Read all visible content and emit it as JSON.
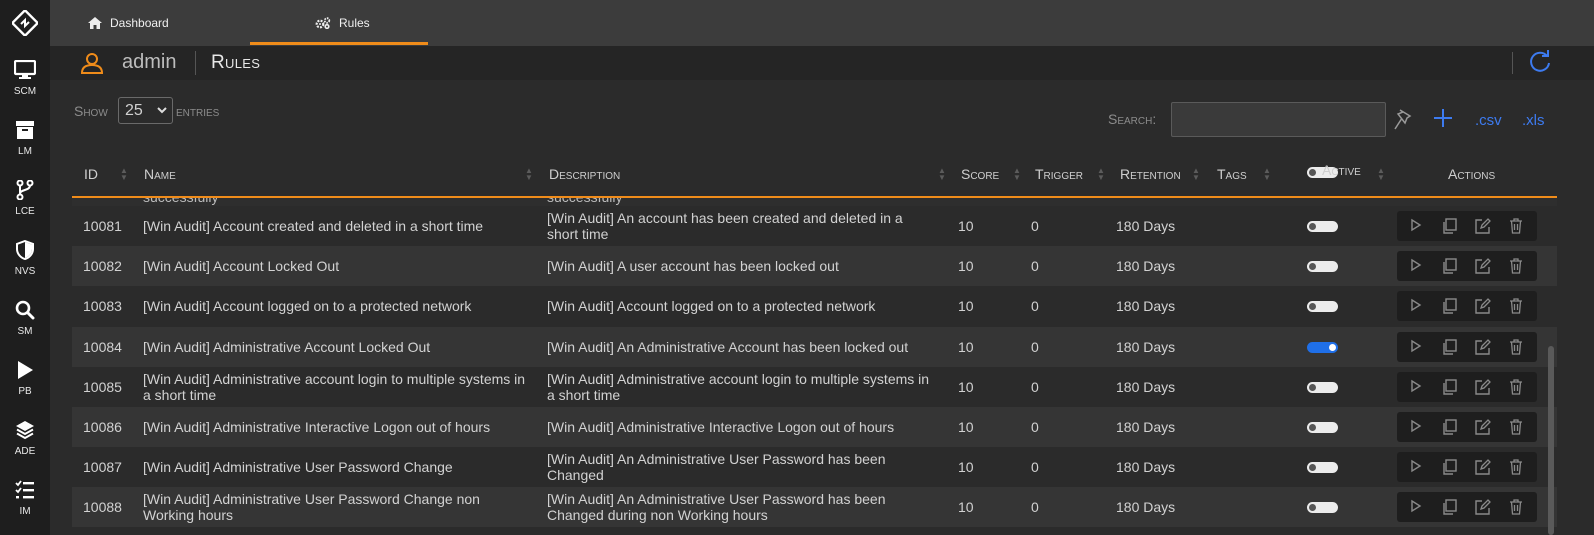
{
  "sidebar": {
    "items": [
      {
        "label": "SCM",
        "icon": "monitor-icon"
      },
      {
        "label": "LM",
        "icon": "archive-icon"
      },
      {
        "label": "LCE",
        "icon": "branch-icon"
      },
      {
        "label": "NVS",
        "icon": "shield-icon"
      },
      {
        "label": "SM",
        "icon": "search-icon"
      },
      {
        "label": "PB",
        "icon": "play-icon"
      },
      {
        "label": "ADE",
        "icon": "layers-icon"
      },
      {
        "label": "IM",
        "icon": "list-check-icon"
      }
    ]
  },
  "tabs": [
    {
      "label": "Dashboard",
      "icon": "home-icon"
    },
    {
      "label": "Rules",
      "icon": "cogs-icon",
      "active": true
    }
  ],
  "header": {
    "username": "admin",
    "title": "Rules"
  },
  "controls": {
    "show_label": "Show",
    "entries_value": "25",
    "entries_label": "entries",
    "search_label": "Search:",
    "search_value": "",
    "csv_label": ".csv",
    "xls_label": ".xls"
  },
  "columns": {
    "id": "ID",
    "name": "Name",
    "description": "Description",
    "score": "Score",
    "trigger": "Trigger",
    "retention": "Retention",
    "tags": "Tags",
    "active": "Active",
    "actions": "Actions"
  },
  "peek_text": "successfully",
  "rows": [
    {
      "id": "10081",
      "name": "[Win Audit] Account created and deleted in a short time",
      "description": "[Win Audit] An account has been created and deleted in a short time",
      "score": "10",
      "trigger": "0",
      "retention": "180 Days",
      "active": false
    },
    {
      "id": "10082",
      "name": "[Win Audit] Account Locked Out",
      "description": "[Win Audit] A user account has been locked out",
      "score": "10",
      "trigger": "0",
      "retention": "180 Days",
      "active": false
    },
    {
      "id": "10083",
      "name": "[Win Audit] Account logged on to a protected network",
      "description": "[Win Audit] Account logged on to a protected network",
      "score": "10",
      "trigger": "0",
      "retention": "180 Days",
      "active": false
    },
    {
      "id": "10084",
      "name": "[Win Audit] Administrative Account Locked Out",
      "description": "[Win Audit] An Administrative Account has been locked out",
      "score": "10",
      "trigger": "0",
      "retention": "180 Days",
      "active": true
    },
    {
      "id": "10085",
      "name": "[Win Audit] Administrative account login to multiple systems in a short time",
      "description": "[Win Audit] Administrative account login to multiple systems in a short time",
      "score": "10",
      "trigger": "0",
      "retention": "180 Days",
      "active": false
    },
    {
      "id": "10086",
      "name": "[Win Audit] Administrative Interactive Logon out of hours",
      "description": "[Win Audit] Administrative Interactive Logon out of hours",
      "score": "10",
      "trigger": "0",
      "retention": "180 Days",
      "active": false
    },
    {
      "id": "10087",
      "name": "[Win Audit] Administrative User Password Change",
      "description": "[Win Audit] An Administrative User Password has been Changed",
      "score": "10",
      "trigger": "0",
      "retention": "180 Days",
      "active": false
    },
    {
      "id": "10088",
      "name": "[Win Audit] Administrative User Password Change non Working hours",
      "description": "[Win Audit] An Administrative User Password has been Changed during non Working hours",
      "score": "10",
      "trigger": "0",
      "retention": "180 Days",
      "active": false
    }
  ],
  "colors": {
    "accent": "#f08c1a",
    "link": "#3d7bf0",
    "toggle_on": "#1f6fe8"
  }
}
